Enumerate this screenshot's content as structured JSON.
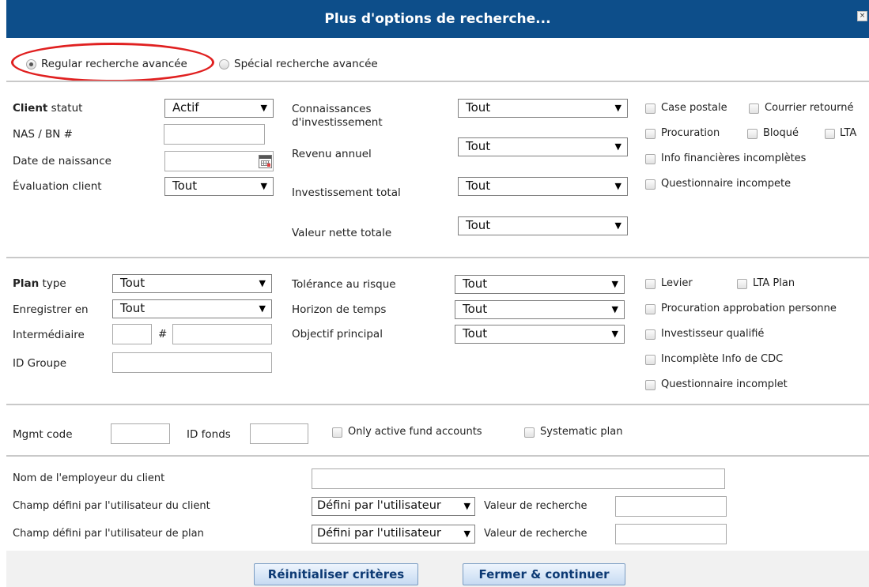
{
  "window": {
    "title": "Plus d'options de recherche...",
    "close_symbol": "×"
  },
  "search_mode": {
    "regular_label": "Regular recherche avancée",
    "special_label": "Spécial recherche avancée",
    "selected": "regular"
  },
  "client": {
    "status_bold": "Client",
    "status_label": " statut",
    "status_value": "Actif",
    "nas_label": "NAS / BN #",
    "dob_label": "Date de naissance",
    "evaluation_label": "Évaluation client",
    "evaluation_value": "Tout",
    "connaissances_label_1": "Connaissances",
    "connaissances_label_2": "d'investissement",
    "connaissances_value": "Tout",
    "revenu_label": "Revenu annuel",
    "revenu_value": "Tout",
    "investissement_label": "Investissement total",
    "investissement_value": "Tout",
    "valeur_label": "Valeur nette totale",
    "valeur_value": "Tout",
    "checks": {
      "case_postale": "Case postale",
      "courrier_retourne": "Courrier retourné",
      "procuration": "Procuration",
      "bloque": "Bloqué",
      "lta": "LTA",
      "info_financieres": "Info financières incomplètes",
      "questionnaire": "Questionnaire incompete"
    }
  },
  "plan": {
    "type_bold": "Plan",
    "type_label": " type",
    "type_value": "Tout",
    "enregistrer_label": "Enregistrer en",
    "enregistrer_value": "Tout",
    "intermediaire_label": "Intermédiaire",
    "hash_label": "#",
    "groupe_label": "ID Groupe",
    "tolerance_label": "Tolérance au risque",
    "tolerance_value": "Tout",
    "horizon_label": "Horizon de temps",
    "horizon_value": "Tout",
    "objectif_label": "Objectif principal",
    "objectif_value": "Tout",
    "checks": {
      "levier": "Levier",
      "lta_plan": "LTA Plan",
      "procuration_approbation": "Procuration approbation personne",
      "investisseur_qualifie": "Investisseur qualifié",
      "incomplete_cdc": "Incomplète Info de CDC",
      "questionnaire_incomplet": "Questionnaire incomplet"
    }
  },
  "funds": {
    "mgmt_label": "Mgmt code",
    "fonds_label": "ID fonds",
    "active_label": "Only active fund accounts",
    "systematic_label": "Systematic plan"
  },
  "employer": {
    "employeur_label": "Nom de l'employeur du client",
    "champ_client_label": "Champ défini par l'utilisateur du client",
    "champ_client_value": "Défini par l'utilisateur",
    "champ_plan_label": "Champ défini par l'utilisateur de plan",
    "champ_plan_value": "Défini par l'utilisateur",
    "valeur_label_1": "Valeur de recherche",
    "valeur_label_2": "Valeur de recherche"
  },
  "buttons": {
    "reset": "Réinitialiser critères",
    "close": "Fermer & continuer"
  },
  "dropdown_arrow": "▼",
  "colors": {
    "title_bar": "#0d4e8a",
    "highlight_oval": "#e02020",
    "button_text": "#0d3a74"
  }
}
